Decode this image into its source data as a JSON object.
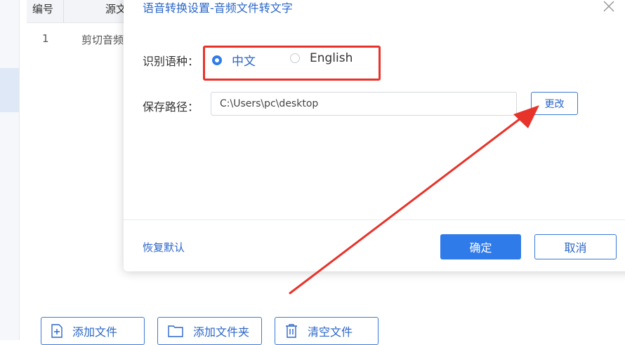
{
  "background": {
    "table_headers": [
      "编号",
      "源文"
    ],
    "rows": [
      {
        "index": "1",
        "name": "剪切音频"
      }
    ],
    "bottom_buttons": {
      "add_file": "添加文件",
      "add_folder": "添加文件夹",
      "clear_files": "清空文件"
    }
  },
  "dialog": {
    "title": "语音转换设置-音频文件转文字",
    "language_label": "识别语种：",
    "language_options": [
      {
        "label": "中文",
        "selected": true
      },
      {
        "label": "English",
        "selected": false
      }
    ],
    "save_path_label": "保存路径：",
    "save_path_value": "C:\\Users\\pc\\desktop",
    "change_button": "更改",
    "restore_default": "恢复默认",
    "ok_button": "确定",
    "cancel_button": "取消"
  },
  "colors": {
    "accent": "#2f7bea",
    "annotation": "#e8332a"
  },
  "icons": {
    "close": "close-icon",
    "add_file": "file-plus-icon",
    "add_folder": "folder-icon",
    "clear": "trash-icon"
  }
}
